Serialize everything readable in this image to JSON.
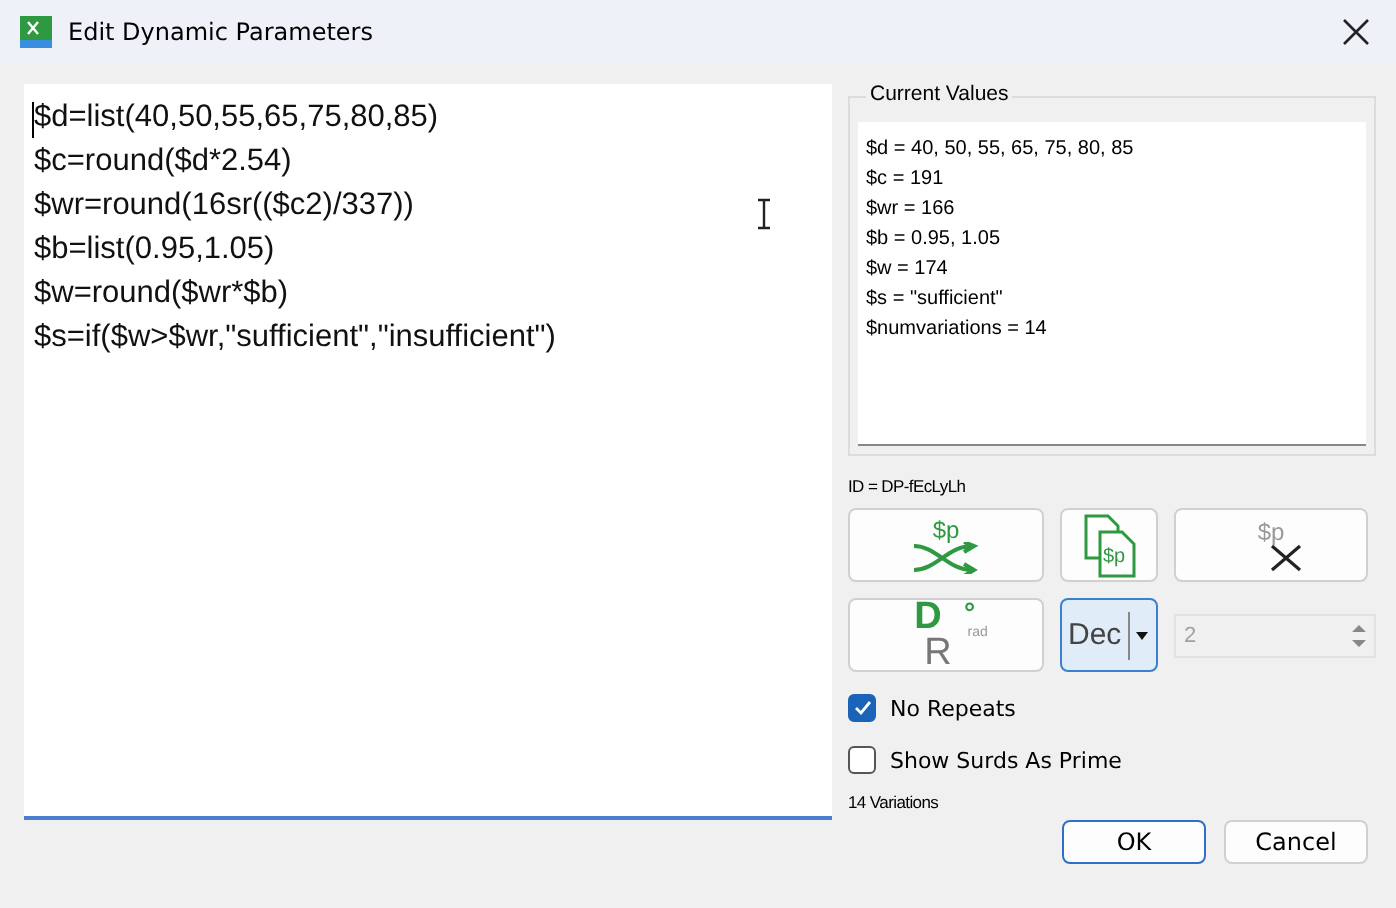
{
  "window": {
    "title": "Edit Dynamic Parameters"
  },
  "editor": {
    "lines": [
      "$d=list(40,50,55,65,75,80,85)",
      "$c=round($d*2.54)",
      "$wr=round(16sr(($c2)/337))",
      "$b=list(0.95,1.05)",
      "$w=round($wr*$b)",
      "$s=if($w>$wr,\"sufficient\",\"insufficient\")"
    ]
  },
  "current_values": {
    "title": "Current Values",
    "lines": [
      "$d = 40, 50, 55, 65, 75, 80, 85",
      "$c = 191",
      "$wr = 166",
      "$b = 0.95, 1.05",
      "$w = 174",
      "$s = \"sufficient\"",
      "$numvariations = 14"
    ]
  },
  "id_label": "ID = DP-fEcLyLh",
  "tool_buttons": [
    {
      "kind": "shuffle",
      "text": "$p",
      "disabled": false
    },
    {
      "kind": "copy",
      "text": "$p",
      "disabled": false
    },
    {
      "kind": "delete",
      "text": "$p",
      "disabled": true
    }
  ],
  "angle_button": {
    "degree": "D",
    "degree_mark": "°",
    "radian": "R",
    "radian_mark": "rad"
  },
  "format_dropdown": {
    "value": "Dec"
  },
  "decimals_field": {
    "value": "2",
    "disabled": true
  },
  "checkboxes": [
    {
      "label": "No Repeats",
      "checked": true
    },
    {
      "label": "Show Surds As Prime",
      "checked": false
    }
  ],
  "variations": "14 Variations",
  "buttons": [
    {
      "label": "OK",
      "default": true
    },
    {
      "label": "Cancel",
      "default": false
    }
  ]
}
